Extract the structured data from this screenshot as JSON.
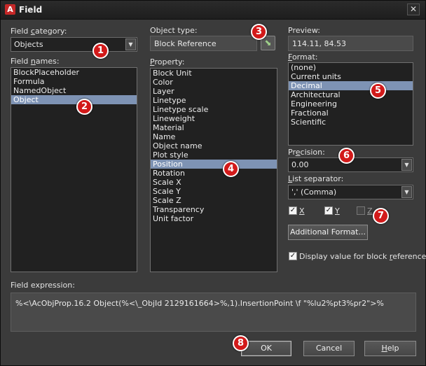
{
  "window": {
    "title": "Field",
    "app_icon_letter": "A",
    "close_glyph": "✕"
  },
  "field_category": {
    "label_pre": "Field ",
    "label_key": "c",
    "label_post": "ategory:",
    "value": "Objects"
  },
  "field_names": {
    "label_pre": "Field ",
    "label_key": "n",
    "label_post": "ames:",
    "items": [
      "BlockPlaceholder",
      "Formula",
      "NamedObject",
      "Object"
    ],
    "selected_index": 3
  },
  "object_type": {
    "label": "Object type:",
    "value": "Block Reference"
  },
  "property": {
    "label_key": "P",
    "label_post": "roperty:",
    "items": [
      "Block Unit",
      "Color",
      "Layer",
      "Linetype",
      "Linetype scale",
      "Lineweight",
      "Material",
      "Name",
      "Object name",
      "Plot style",
      "Position",
      "Rotation",
      "Scale X",
      "Scale Y",
      "Scale Z",
      "Transparency",
      "Unit factor"
    ],
    "selected_index": 10
  },
  "preview": {
    "label": "Preview:",
    "value": "114.11, 84.53"
  },
  "format": {
    "label_key": "F",
    "label_post": "ormat:",
    "items": [
      "(none)",
      "Current units",
      "Decimal",
      "Architectural",
      "Engineering",
      "Fractional",
      "Scientific"
    ],
    "selected_index": 2
  },
  "precision": {
    "label_pre": "Pr",
    "label_key": "e",
    "label_post": "cision:",
    "value": "0.00"
  },
  "list_separator": {
    "label_key": "L",
    "label_post": "ist separator:",
    "value": "',' (Comma)"
  },
  "axes": {
    "x_label": "X",
    "x_checked": true,
    "y_label": "Y",
    "y_checked": true,
    "z_label": "Z",
    "z_checked": false
  },
  "additional_format_label": "Additional Format...",
  "display_value": {
    "label": "Display value for block ",
    "label_key": "r",
    "label_post": "eference",
    "checked": true
  },
  "field_expression": {
    "label": "Field expression:",
    "value": "%<\\AcObjProp.16.2 Object(%<\\_ObjId 2129161664>%,1).InsertionPoint \\f \"%lu2%pt3%pr2\">%"
  },
  "buttons": {
    "ok": "OK",
    "cancel": "Cancel",
    "help_key": "H",
    "help_post": "elp"
  },
  "badges": [
    "1",
    "2",
    "3",
    "4",
    "5",
    "6",
    "7",
    "8"
  ],
  "colors": {
    "badge": "#d21a1a",
    "selection": "#7e93b4",
    "dialog_bg": "#3b3b3b"
  }
}
